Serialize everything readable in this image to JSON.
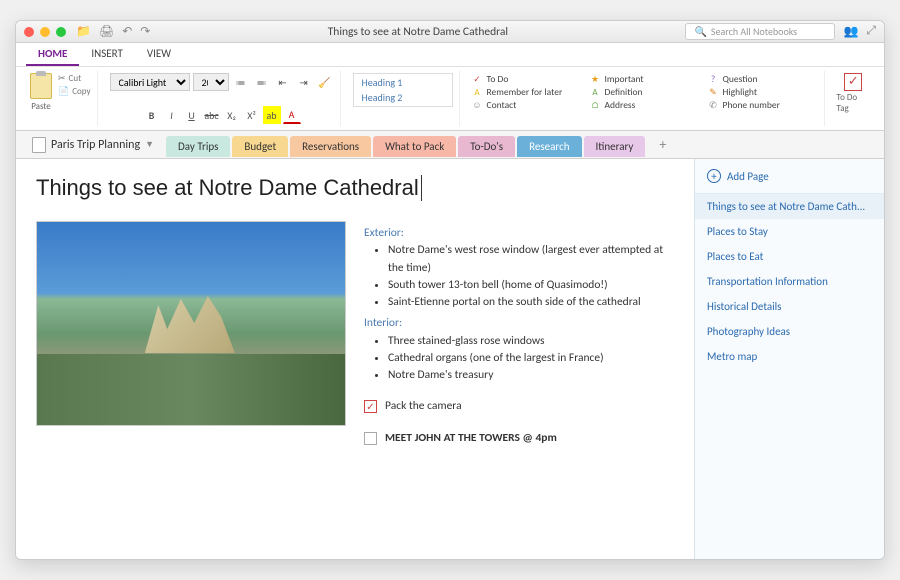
{
  "window": {
    "title": "Things to see at Notre Dame Cathedral"
  },
  "search": {
    "placeholder": "Search All Notebooks"
  },
  "ribbonTabs": [
    "HOME",
    "INSERT",
    "VIEW"
  ],
  "ribbonActiveTab": 0,
  "clipboard": {
    "paste": "Paste",
    "cut": "Cut",
    "copy": "Copy"
  },
  "font": {
    "family": "Calibri Light",
    "size": "20"
  },
  "styles": [
    "Heading 1",
    "Heading 2"
  ],
  "tags": [
    {
      "label": "To Do",
      "icon": "✓",
      "color": "#c44"
    },
    {
      "label": "Important",
      "icon": "★",
      "color": "#e8a020"
    },
    {
      "label": "Question",
      "icon": "?",
      "color": "#8060c0"
    },
    {
      "label": "Remember for later",
      "icon": "A",
      "color": "#e8c020"
    },
    {
      "label": "Definition",
      "icon": "A",
      "color": "#6aa84f"
    },
    {
      "label": "Highlight",
      "icon": "✎",
      "color": "#d88020"
    },
    {
      "label": "Contact",
      "icon": "☺",
      "color": "#888"
    },
    {
      "label": "Address",
      "icon": "⌂",
      "color": "#6aa84f"
    },
    {
      "label": "Phone number",
      "icon": "✆",
      "color": "#888"
    }
  ],
  "todoTag": "To Do Tag",
  "notebook": {
    "name": "Paris Trip Planning"
  },
  "sections": [
    {
      "label": "Day Trips",
      "color": "#c8e8e0"
    },
    {
      "label": "Budget",
      "color": "#f8d890"
    },
    {
      "label": "Reservations",
      "color": "#f8c8a0"
    },
    {
      "label": "What to Pack",
      "color": "#f8b8a8"
    },
    {
      "label": "To-Do's",
      "color": "#e8b8d0"
    },
    {
      "label": "Research",
      "color": "#6ab0d8"
    },
    {
      "label": "Itinerary",
      "color": "#e8c8e8"
    }
  ],
  "activeSection": 5,
  "page": {
    "title": "Things to see at Notre Dame Cathedral",
    "exteriorHeading": "Exterior:",
    "exterior": [
      "Notre Dame's west rose window (largest ever attempted at the time)",
      "South tower 13-ton bell (home of Quasimodo!)",
      "Saint-Etienne portal on the south side of the cathedral"
    ],
    "interiorHeading": "Interior:",
    "interior": [
      "Three stained-glass rose windows",
      "Cathedral organs (one of the largest in France)",
      "Notre Dame's treasury"
    ],
    "todo1": "Pack the camera",
    "todo2": "MEET JOHN AT THE TOWERS @ 4pm"
  },
  "addPage": "Add Page",
  "pages": [
    "Things to see at Notre Dame Cath...",
    "Places to Stay",
    "Places to Eat",
    "Transportation Information",
    "Historical Details",
    "Photography Ideas",
    "Metro map"
  ],
  "activePage": 0
}
